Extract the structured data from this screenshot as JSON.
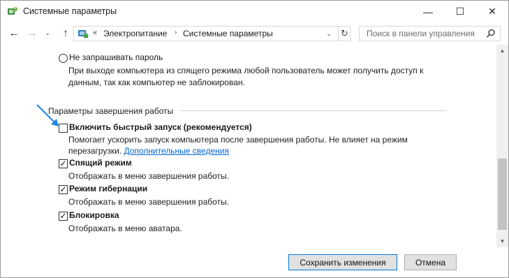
{
  "window": {
    "title": "Системные параметры",
    "controls": {
      "minimize": "—",
      "maximize": "☐",
      "close": "✕"
    }
  },
  "nav": {
    "back": "←",
    "forward": "→",
    "history": "⌄",
    "up": "↑"
  },
  "address": {
    "prefix": "«",
    "crumbs": [
      "Электропитание",
      "Системные параметры"
    ],
    "separator": "›",
    "dropdown": "⌄",
    "refresh": "↻"
  },
  "search": {
    "placeholder": "Поиск в панели управления"
  },
  "password": {
    "option_label": "Не запрашивать пароль",
    "desc_line1": "При выходе компьютера из спящего режима любой пользователь может получить доступ к",
    "desc_line2": "данным, так как компьютер не заблокирован.",
    "selected": false
  },
  "shutdown": {
    "section_title": "Параметры завершения работы",
    "options": [
      {
        "label": "Включить быстрый запуск (рекомендуется)",
        "desc_line1": "Помогает ускорить запуск компьютера после завершения работы. Не влияет на режим",
        "desc_line2": "перезагрузки.",
        "link": "Дополнительные сведения",
        "checked": false
      },
      {
        "label": "Спящий режим",
        "desc": "Отображать в меню завершения работы.",
        "checked": true
      },
      {
        "label": "Режим гибернации",
        "desc": "Отображать в меню завершения работы.",
        "checked": true
      },
      {
        "label": "Блокировка",
        "desc": "Отображать в меню аватара.",
        "checked": true
      }
    ]
  },
  "checkmark": "✓",
  "scrollbar": {
    "up": "▲",
    "down": "▼"
  },
  "buttons": {
    "save": "Сохранить изменения",
    "cancel": "Отмена"
  },
  "colors": {
    "accent": "#0078d7",
    "link": "#0066cc",
    "arrow": "#1e88e5"
  }
}
